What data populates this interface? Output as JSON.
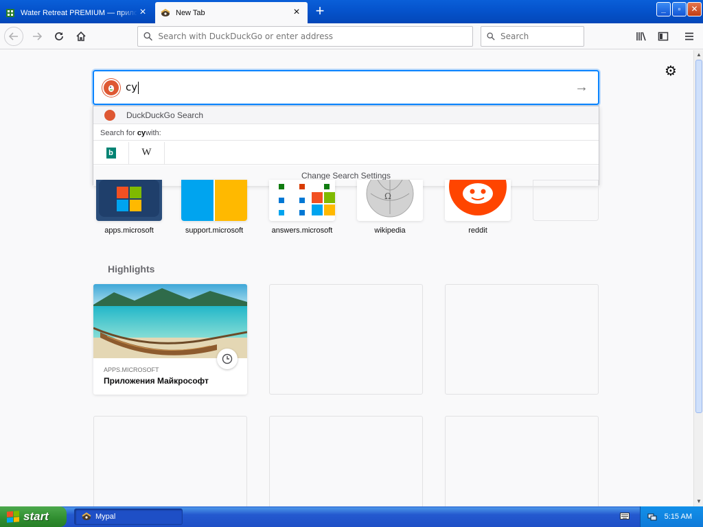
{
  "tabs": [
    {
      "title": "Water Retreat PREMIUM — прилож",
      "active": false
    },
    {
      "title": "New Tab",
      "active": true
    }
  ],
  "navbar": {
    "url_placeholder": "Search with DuckDuckGo or enter address",
    "search_placeholder": "Search"
  },
  "search": {
    "query": "cy",
    "suggestion": "DuckDuckGo Search",
    "search_for_prefix": "Search for ",
    "search_for_term": "cy",
    "search_for_suffix": " with:",
    "change_settings": "Change Search Settings",
    "engines": [
      "bing",
      "wikipedia"
    ],
    "wiki_glyph": "W",
    "bing_glyph": "b"
  },
  "top_sites": [
    {
      "label": "apps.microsoft"
    },
    {
      "label": "support.microsoft"
    },
    {
      "label": "answers.microsoft"
    },
    {
      "label": "wikipedia"
    },
    {
      "label": "reddit"
    },
    {
      "label": ""
    }
  ],
  "highlights": {
    "heading": "Highlights",
    "cards": [
      {
        "host": "APPS.MICROSOFT",
        "title": "Приложения Майкрософт"
      }
    ]
  },
  "taskbar": {
    "start": "start",
    "window": "Mypal",
    "clock": "5:15 AM"
  },
  "colors": {
    "accent": "#0a84ff",
    "ddg": "#de5833",
    "xp_blue": "#0553cc",
    "start_green": "#2f8d2f"
  },
  "icons": {
    "back": "arrow-left-icon",
    "forward": "arrow-right-icon",
    "reload": "reload-icon",
    "home": "home-icon",
    "library": "library-icon",
    "sidebar": "sidebar-icon",
    "menu": "hamburger-icon",
    "settings": "gear-icon"
  }
}
